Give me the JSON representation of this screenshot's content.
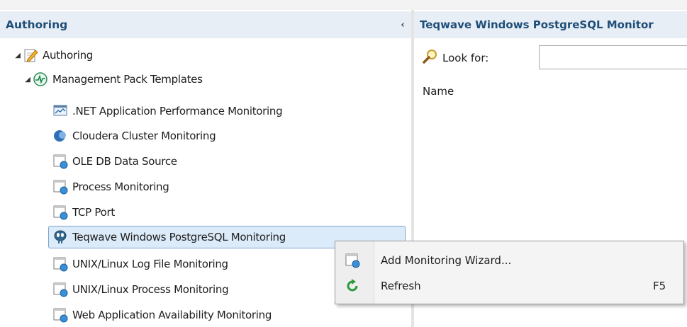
{
  "left_pane": {
    "title": "Authoring",
    "collapse_glyph": "‹"
  },
  "right_pane": {
    "title": "Teqwave Windows PostgreSQL Monitor",
    "look_for_label": "Look for:",
    "look_for_value": "",
    "column_name": "Name"
  },
  "tree": {
    "root": {
      "label": "Authoring",
      "icon": "authoring-icon",
      "expanded": true
    },
    "templates": {
      "label": "Management Pack Templates",
      "icon": "template-icon",
      "expanded": true
    },
    "items": [
      {
        "label": ".NET Application Performance Monitoring",
        "icon": "apm-icon"
      },
      {
        "label": "Cloudera Cluster Monitoring",
        "icon": "cloudera-icon"
      },
      {
        "label": "OLE DB Data Source",
        "icon": "template-window-icon"
      },
      {
        "label": "Process Monitoring",
        "icon": "template-window-icon"
      },
      {
        "label": "TCP Port",
        "icon": "template-window-icon"
      },
      {
        "label": "Teqwave Windows PostgreSQL Monitoring",
        "icon": "postgresql-icon",
        "selected": true
      },
      {
        "label": "UNIX/Linux Log File Monitoring",
        "icon": "template-window-icon"
      },
      {
        "label": "UNIX/Linux Process Monitoring",
        "icon": "template-window-icon"
      },
      {
        "label": "Web Application Availability Monitoring",
        "icon": "template-window-icon"
      }
    ]
  },
  "context_menu": {
    "items": [
      {
        "label": "Add Monitoring Wizard...",
        "icon": "wizard-icon",
        "shortcut": ""
      },
      {
        "label": "Refresh",
        "icon": "refresh-icon",
        "shortcut": "F5"
      }
    ]
  },
  "colors": {
    "header_text": "#1f4e79",
    "header_bg": "#e8eef5",
    "selection_bg": "#dcebfa",
    "selection_border": "#7da2ce"
  }
}
